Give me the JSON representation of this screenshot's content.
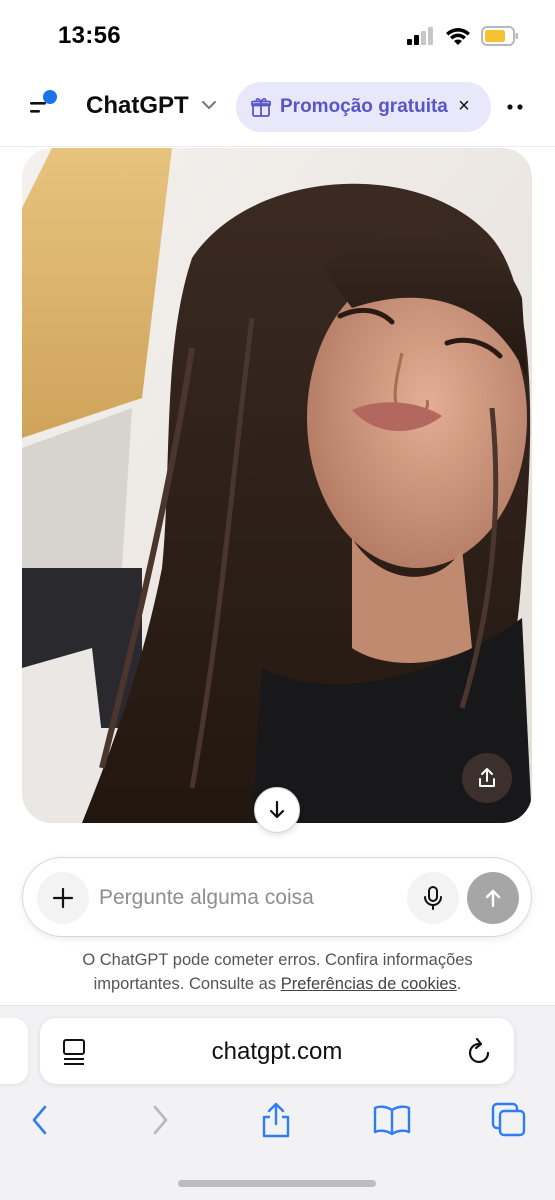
{
  "status_bar": {
    "time": "13:56"
  },
  "header": {
    "title": "ChatGPT",
    "promo_label": "Promoção gratuita",
    "close_symbol": "×"
  },
  "composer": {
    "placeholder": "Pergunte alguma coisa"
  },
  "disclaimer": {
    "text_line1": "O ChatGPT pode cometer erros. Confira informações",
    "text_line2_prefix": "importantes. Consulte as ",
    "cookie_link": "Preferências de cookies",
    "text_line2_suffix": "."
  },
  "browser": {
    "url": "chatgpt.com"
  },
  "icons": {
    "menu": "menu-icon",
    "chevron": "chevron-down-icon",
    "gift": "gift-icon",
    "more": "more-icon",
    "share_photo": "share-icon",
    "scroll_down": "arrow-down-icon",
    "attach": "plus-icon",
    "mic": "microphone-icon",
    "send": "arrow-up-icon",
    "page_menu": "page-menu-icon",
    "reload": "reload-icon",
    "back": "back-icon",
    "forward": "forward-icon",
    "share": "share-icon",
    "bookmarks": "book-icon",
    "tabs": "tabs-icon"
  },
  "colors": {
    "accent_blue": "#1a73e8",
    "promo_bg": "#e9e8fb",
    "promo_text": "#5a54c9",
    "send_disabled": "#a6a6a6",
    "safari_blue": "#2f7cf6"
  }
}
